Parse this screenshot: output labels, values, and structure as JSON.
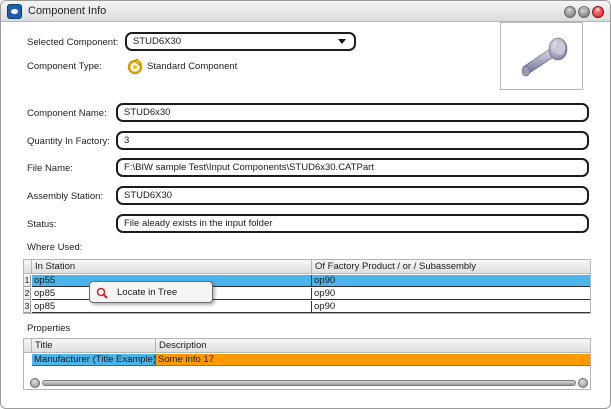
{
  "window": {
    "title": "Component Info"
  },
  "header": {
    "selected_component_label": "Selected Component:",
    "selected_component_value": "STUD6X30",
    "component_type_label": "Component Type:",
    "component_type_value": "Standard Component"
  },
  "fields": {
    "component_name_label": "Component Name:",
    "component_name_value": "STUD6x30",
    "quantity_label": "Quantity In Factory:",
    "quantity_value": "3",
    "file_name_label": "File Name:",
    "file_name_value": "F:\\BIW sample Test\\Input Components\\STUD6x30.CATPart",
    "assembly_station_label": "Assembly Station:",
    "assembly_station_value": "STUD6X30",
    "status_label": "Status:",
    "status_value": "File aleady exists in the input folder"
  },
  "where_used": {
    "label": "Where Used:",
    "columns": [
      "In Station",
      "Of Factory Product / or / Subassembly"
    ],
    "rows": [
      {
        "num": "1",
        "station": "op55",
        "product": "op90"
      },
      {
        "num": "2",
        "station": "op85",
        "product": "op90"
      },
      {
        "num": "3",
        "station": "op85",
        "product": "op90"
      }
    ]
  },
  "context_menu": {
    "item": "Locate in Tree"
  },
  "properties": {
    "label": "Properties",
    "columns": [
      "Title",
      "Description"
    ],
    "rows": [
      {
        "title": "Manufacturer (Title Example)",
        "description": "Some info 17"
      }
    ]
  },
  "colors": {
    "selection": "#4cb4ea",
    "highlight": "#ff9900",
    "border": "#1c1c1c"
  }
}
